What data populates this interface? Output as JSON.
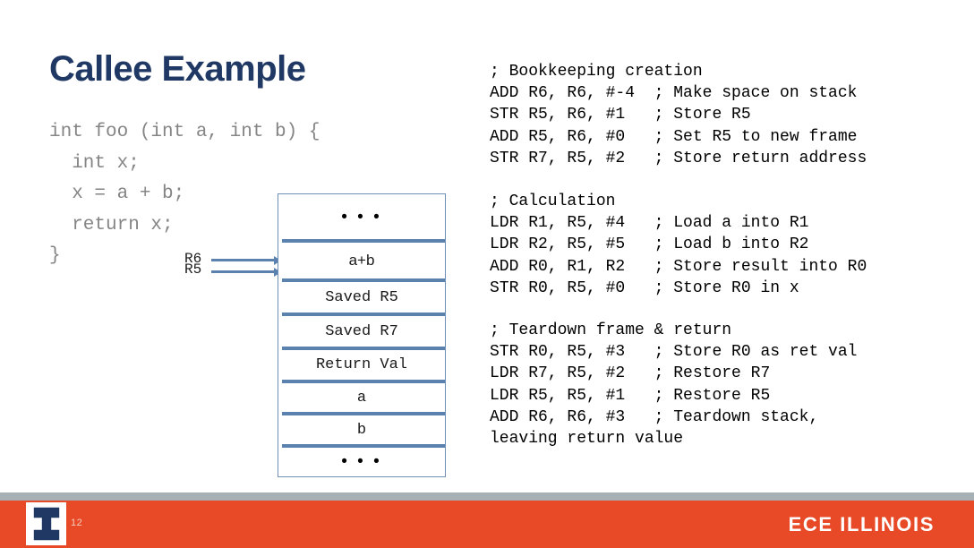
{
  "slide": {
    "title": "Callee Example",
    "page_number": "12",
    "brand": "ECE ILLINOIS",
    "colors": {
      "title_navy": "#1F3864",
      "footer_orange": "#E84A27",
      "footer_gray": "#A7B0B4",
      "stack_divider_blue": "#5B81AF",
      "stack_border_blue": "#6F8FB5",
      "code_gray": "#858585",
      "page_number_tint": "#F6CDBE"
    }
  },
  "c_code": {
    "text": "int foo (int a, int b) {\n  int x;\n  x = a + b;\n  return x;\n}",
    "lines": [
      "int foo (int a, int b) {",
      "  int x;",
      "  x = a + b;",
      "  return x;",
      "}"
    ]
  },
  "pointers": {
    "r6_label": "R6",
    "r5_label": "R5"
  },
  "stack": {
    "rows": [
      {
        "label": "• • •",
        "font": "dots"
      },
      {
        "label": "a+b",
        "font": "sans"
      },
      {
        "label": "Saved R5",
        "font": "mono"
      },
      {
        "label": "Saved R7",
        "font": "mono"
      },
      {
        "label": "Return Val",
        "font": "mono"
      },
      {
        "label": "a",
        "font": "mono"
      },
      {
        "label": "b",
        "font": "mono"
      },
      {
        "label": "• • •",
        "font": "dots"
      }
    ]
  },
  "assembly": {
    "blocks": [
      {
        "comment_header": "; Bookkeeping creation",
        "text": "; Bookkeeping creation\nADD R6, R6, #-4  ; Make space on stack\nSTR R5, R6, #1   ; Store R5\nADD R5, R6, #0   ; Set R5 to new frame\nSTR R7, R5, #2   ; Store return address",
        "lines": [
          "; Bookkeeping creation",
          "ADD R6, R6, #-4  ; Make space on stack",
          "STR R5, R6, #1   ; Store R5",
          "ADD R5, R6, #0   ; Set R5 to new frame",
          "STR R7, R5, #2   ; Store return address"
        ]
      },
      {
        "comment_header": "; Calculation",
        "text": "; Calculation\nLDR R1, R5, #4   ; Load a into R1\nLDR R2, R5, #5   ; Load b into R2\nADD R0, R1, R2   ; Store result into R0\nSTR R0, R5, #0   ; Store R0 in x",
        "lines": [
          "; Calculation",
          "LDR R1, R5, #4   ; Load a into R1",
          "LDR R2, R5, #5   ; Load b into R2",
          "ADD R0, R1, R2   ; Store result into R0",
          "STR R0, R5, #0   ; Store R0 in x"
        ]
      },
      {
        "comment_header": "; Teardown frame & return",
        "text": "; Teardown frame & return\nSTR R0, R5, #3   ; Store R0 as ret val\nLDR R7, R5, #2   ; Restore R7\nLDR R5, R5, #1   ; Restore R5\nADD R6, R6, #3   ; Teardown stack,\nleaving return value",
        "lines": [
          "; Teardown frame & return",
          "STR R0, R5, #3   ; Store R0 as ret val",
          "LDR R7, R5, #2   ; Restore R7",
          "LDR R5, R5, #1   ; Restore R5",
          "ADD R6, R6, #3   ; Teardown stack,",
          "leaving return value"
        ]
      }
    ]
  },
  "icons": {
    "logo": "illinois-block-i-logo"
  }
}
